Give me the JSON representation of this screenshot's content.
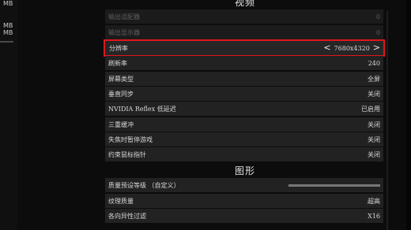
{
  "left_panel": {
    "mem_top": "MB",
    "mem_1": "MB",
    "mem_2": "MB"
  },
  "video_section": {
    "title": "视频",
    "rows": [
      {
        "label": "输出适配器",
        "value": "0"
      },
      {
        "label": "输出显示器",
        "value": "0"
      },
      {
        "label": "分辨率",
        "value": "7680x4320",
        "prev_arrow": "<",
        "next_arrow": ">"
      },
      {
        "label": "刷新率",
        "value": "240"
      },
      {
        "label": "屏幕类型",
        "value": "全屏"
      },
      {
        "label": "垂直同步",
        "value": "关闭"
      },
      {
        "label": "NVIDIA Reflex 低延迟",
        "value": "已启用"
      },
      {
        "label": "三重缓冲",
        "value": "关闭"
      },
      {
        "label": "失焦时暂停游戏",
        "value": "关闭"
      },
      {
        "label": "约束鼠标指针",
        "value": "关闭"
      }
    ]
  },
  "graphics_section": {
    "title": "图形",
    "rows": [
      {
        "label": "质量预设等级 （自定义）"
      },
      {
        "label": "纹理质量",
        "value": "超高"
      },
      {
        "label": "各向异性过滤",
        "value": "X16"
      }
    ]
  },
  "colors": {
    "selection_border": "#e0161b",
    "row_bg": "#222222"
  }
}
